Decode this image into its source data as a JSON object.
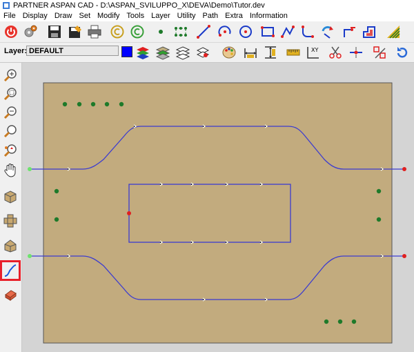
{
  "window": {
    "title": "PARTNER ASPAN CAD - D:\\ASPAN_SVILUPPO_X\\DEVA\\Demo\\Tutor.dev"
  },
  "menu": [
    {
      "label": "File"
    },
    {
      "label": "Display"
    },
    {
      "label": "Draw"
    },
    {
      "label": "Set"
    },
    {
      "label": "Modify"
    },
    {
      "label": "Tools"
    },
    {
      "label": "Layer"
    },
    {
      "label": "Utility"
    },
    {
      "label": "Path"
    },
    {
      "label": "Extra"
    },
    {
      "label": "Information"
    }
  ],
  "toolbar_main": {
    "icons": [
      "power-icon",
      "gears-icon",
      "save-icon",
      "save-as-icon",
      "print-icon",
      "undo-icon",
      "redo-icon",
      "point-icon",
      "dotted-rectangle-icon",
      "line-icon",
      "arc-icon",
      "circle-icon",
      "rectangle-icon",
      "polyline-icon",
      "fillet-icon",
      "rotate-arrow-icon",
      "trim-corner-icon",
      "offset-shape-icon",
      "hatch-icon"
    ]
  },
  "toolbar_layer": {
    "label": "Layer:",
    "value": "DEFAULT",
    "color": "#0000ff",
    "icons": [
      "layers-color-icon",
      "layers-green-icon",
      "layers-stack-icon",
      "layers-select-icon",
      "palette-icon",
      "dimension-horizontal-icon",
      "dimension-vertical-icon",
      "measure-ruler-icon",
      "coordinates-icon",
      "scissors-icon",
      "split-line-icon",
      "cut-parts-icon",
      "refresh-icon"
    ]
  },
  "left_tools": [
    {
      "icon": "zoom-in-icon"
    },
    {
      "icon": "zoom-window-icon"
    },
    {
      "icon": "zoom-out-icon"
    },
    {
      "icon": "zoom-icon"
    },
    {
      "icon": "zoom-extents-icon"
    },
    {
      "icon": "pan-hand-icon"
    },
    {
      "icon": "view-iso-box-icon"
    },
    {
      "icon": "view-unfolded-box-icon"
    },
    {
      "icon": "view-box-3d-icon"
    },
    {
      "icon": "curve-path-icon",
      "selected": true
    },
    {
      "icon": "eraser-icon"
    }
  ],
  "drawing": {
    "sheet_color": "#c2ab7e",
    "path_color": "#3b3bd0",
    "start_point_color": "#6ee36e",
    "end_point_color": "#e02020",
    "marker_color": "#1e7a2a"
  }
}
